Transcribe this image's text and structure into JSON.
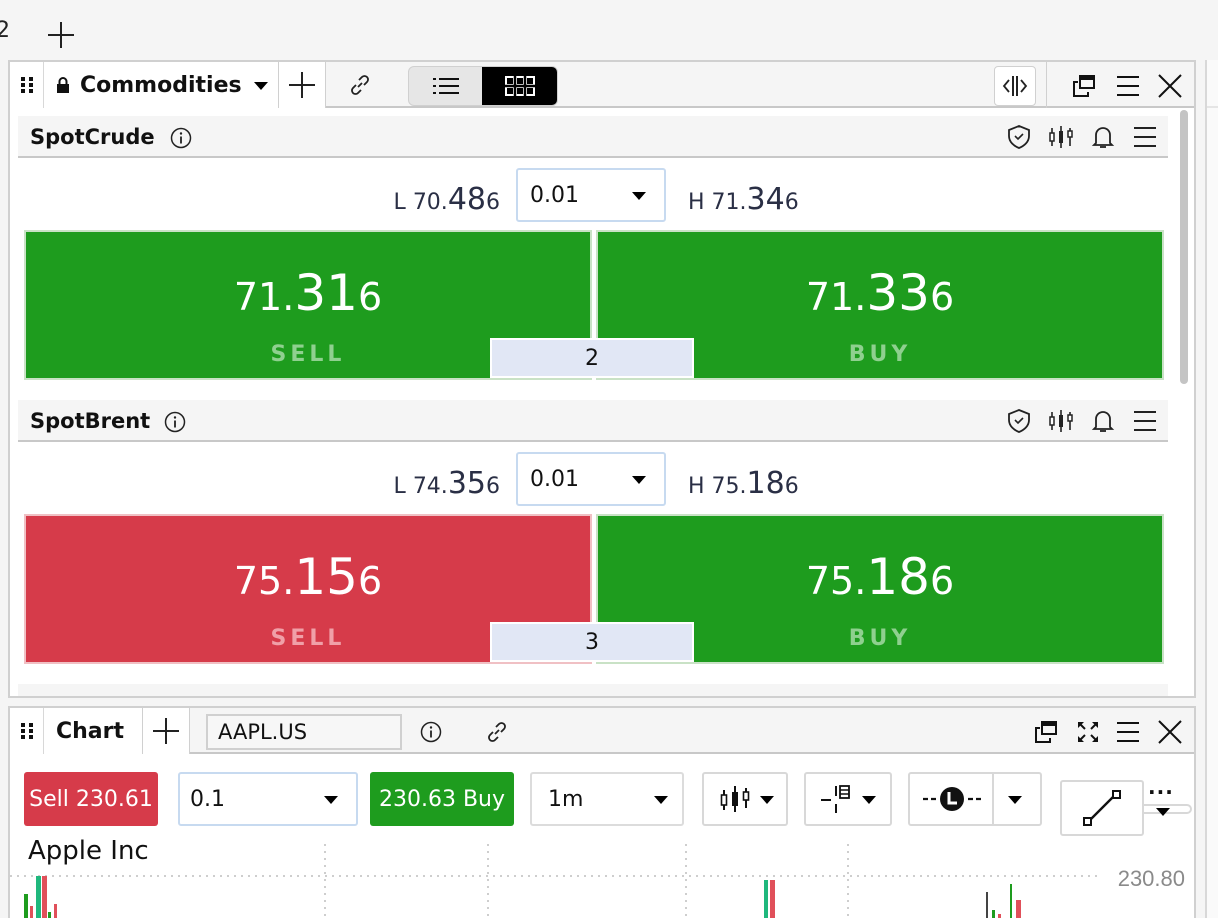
{
  "top_strip": {
    "tab_fragment": "2",
    "add_tab_icon": "plus-icon"
  },
  "panel1": {
    "title": "Commodities",
    "lock_icon": "lock-icon",
    "icons": [
      "drag-handle-icon",
      "lock-icon",
      "chevron-down-icon",
      "plus-icon",
      "link-icon",
      "list-view-icon",
      "grid-view-icon",
      "split-view-icon",
      "undock-icon",
      "menu-icon",
      "close-icon"
    ],
    "view_mode_active": "grid",
    "instruments": [
      {
        "name": "SpotCrude",
        "low": {
          "label": "L",
          "prefix": "70.",
          "big": "48",
          "suffix": "6"
        },
        "high": {
          "label": "H",
          "prefix": "71.",
          "big": "34",
          "suffix": "6"
        },
        "qty": "0.01",
        "sell": {
          "prefix": "71.",
          "big": "31",
          "suffix": "6",
          "label": "SELL",
          "color": "#1e9c1e"
        },
        "buy": {
          "prefix": "71.",
          "big": "33",
          "suffix": "6",
          "label": "BUY",
          "color": "#1e9c1e"
        },
        "spread": "2",
        "header_icons": [
          "shield-check-icon",
          "candlestick-icon",
          "bell-icon",
          "menu-icon"
        ]
      },
      {
        "name": "SpotBrent",
        "low": {
          "label": "L",
          "prefix": "74.",
          "big": "35",
          "suffix": "6"
        },
        "high": {
          "label": "H",
          "prefix": "75.",
          "big": "18",
          "suffix": "6"
        },
        "qty": "0.01",
        "sell": {
          "prefix": "75.",
          "big": "15",
          "suffix": "6",
          "label": "SELL",
          "color": "#d63b4a"
        },
        "buy": {
          "prefix": "75.",
          "big": "18",
          "suffix": "6",
          "label": "BUY",
          "color": "#1e9c1e"
        },
        "spread": "3",
        "header_icons": [
          "shield-check-icon",
          "candlestick-icon",
          "bell-icon",
          "menu-icon"
        ]
      }
    ]
  },
  "panel2": {
    "title": "Chart",
    "symbol": "AAPL.US",
    "toolbar": {
      "sell_label": "Sell 230.61",
      "qty": "0.1",
      "buy_label": "230.63 Buy",
      "timeframe": "1m",
      "more_label": "···"
    },
    "instrument_name": "Apple Inc",
    "price_axis_label": "230.80",
    "colors": {
      "up": "#1fb87d",
      "down": "#e0505a",
      "up_wick": "#1e9c1e",
      "neutral": "#444444"
    }
  }
}
